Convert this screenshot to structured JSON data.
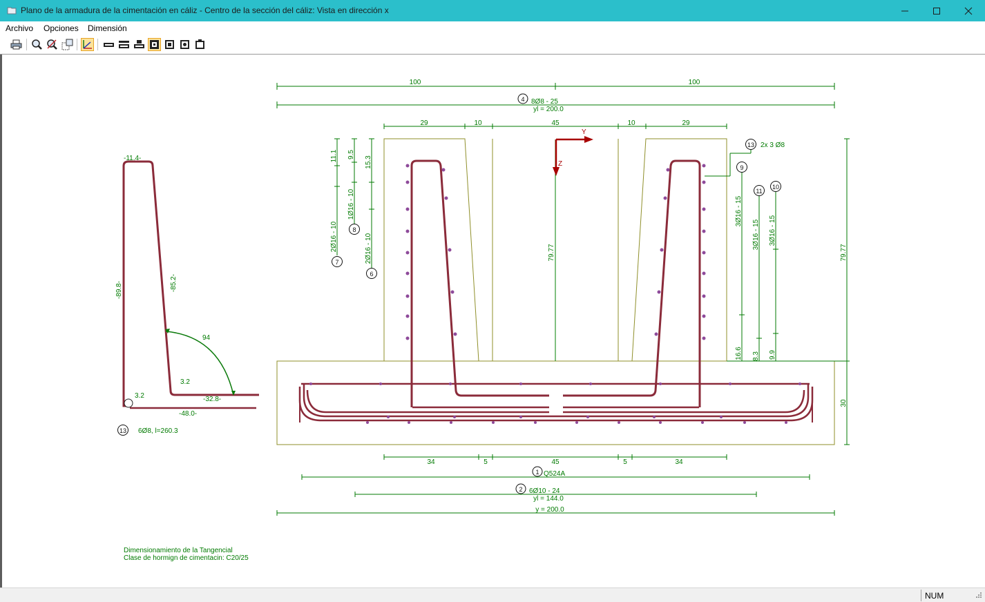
{
  "window": {
    "title": "Plano de la armadura de la cimentación en cáliz - Centro de la sección del cáliz: Vista en dirección x",
    "icon": "folder-icon",
    "controls": [
      "minimize-icon",
      "maximize-icon",
      "close-icon"
    ]
  },
  "menu": {
    "archivo": "Archivo",
    "opciones": "Opciones",
    "dimension": "Dimensión"
  },
  "toolbar": {
    "icons": [
      "print-icon",
      "zoom-icon",
      "zoom-all-icon",
      "zoom-window-icon",
      "axes-icon",
      "view-section-1-icon",
      "view-section-2-icon",
      "view-section-3-icon",
      "view-section-4-icon",
      "view-section-5-icon",
      "view-section-6-icon",
      "view-section-7-icon"
    ],
    "active": [
      "axes-icon",
      "view-section-4-icon"
    ]
  },
  "colors": {
    "titlebar": "#2bbfcb",
    "dimension_text": "#007a00",
    "rebar": "#8b2b3a",
    "outline": "#8f8f2a",
    "axis": "#a80000"
  },
  "bar_shape": {
    "top": "-11.4-",
    "left_leg": "-89.8-",
    "inclined": "-85.2-",
    "angle": "94",
    "hook_left": "3.2",
    "inner": "3.2",
    "foot": "-32.8-",
    "bottom": "-48.0-",
    "mark": "13",
    "description": "6Ø8, l=260.3"
  },
  "dims_top": {
    "half_left": "100",
    "half_right": "100",
    "mark4": "4",
    "bar4": "8Ø8 - 25",
    "bar4_yl": "yl = 200.0",
    "w29_left": "29",
    "w10_left": "10",
    "w45": "45",
    "w10_right": "10",
    "w29_right": "29"
  },
  "dims_left": {
    "d111": "11.1",
    "d95": "9.5",
    "d153": "15.3",
    "bar7": "2Ø16 - 10",
    "bar8": "1Ø16 - 10",
    "bar6": "2Ø16 - 10",
    "mark7": "7",
    "mark8": "8",
    "mark6": "6"
  },
  "dims_right": {
    "mark13": "13",
    "bar13": "2x 3 Ø8",
    "mark9": "9",
    "mark11": "11",
    "mark10": "10",
    "bar9": "3Ø16 - 15",
    "bar11": "3Ø16 - 15",
    "bar10": "3Ø16 - 15",
    "d166": "16.6",
    "d83": "8.3",
    "d99": "9.9",
    "height": "79.77",
    "slab": "30"
  },
  "axes": {
    "y": "Y",
    "z": "Z",
    "height_center": "79.77"
  },
  "dims_bottom": {
    "w34_left": "34",
    "w5_left": "5",
    "w45": "45",
    "w5_right": "5",
    "w34_right": "34",
    "mark1": "1",
    "bar1": "Q524A",
    "mark2": "2",
    "bar2": "6Ø10 - 24",
    "bar2_yl": "yl = 144.0",
    "total": "y = 200.0"
  },
  "notes": {
    "line1": "Dimensionamiento  de  la  Tangencial",
    "line2": "Clase de hormign de cimentacin: C20/25"
  },
  "status": {
    "num": "NUM"
  }
}
